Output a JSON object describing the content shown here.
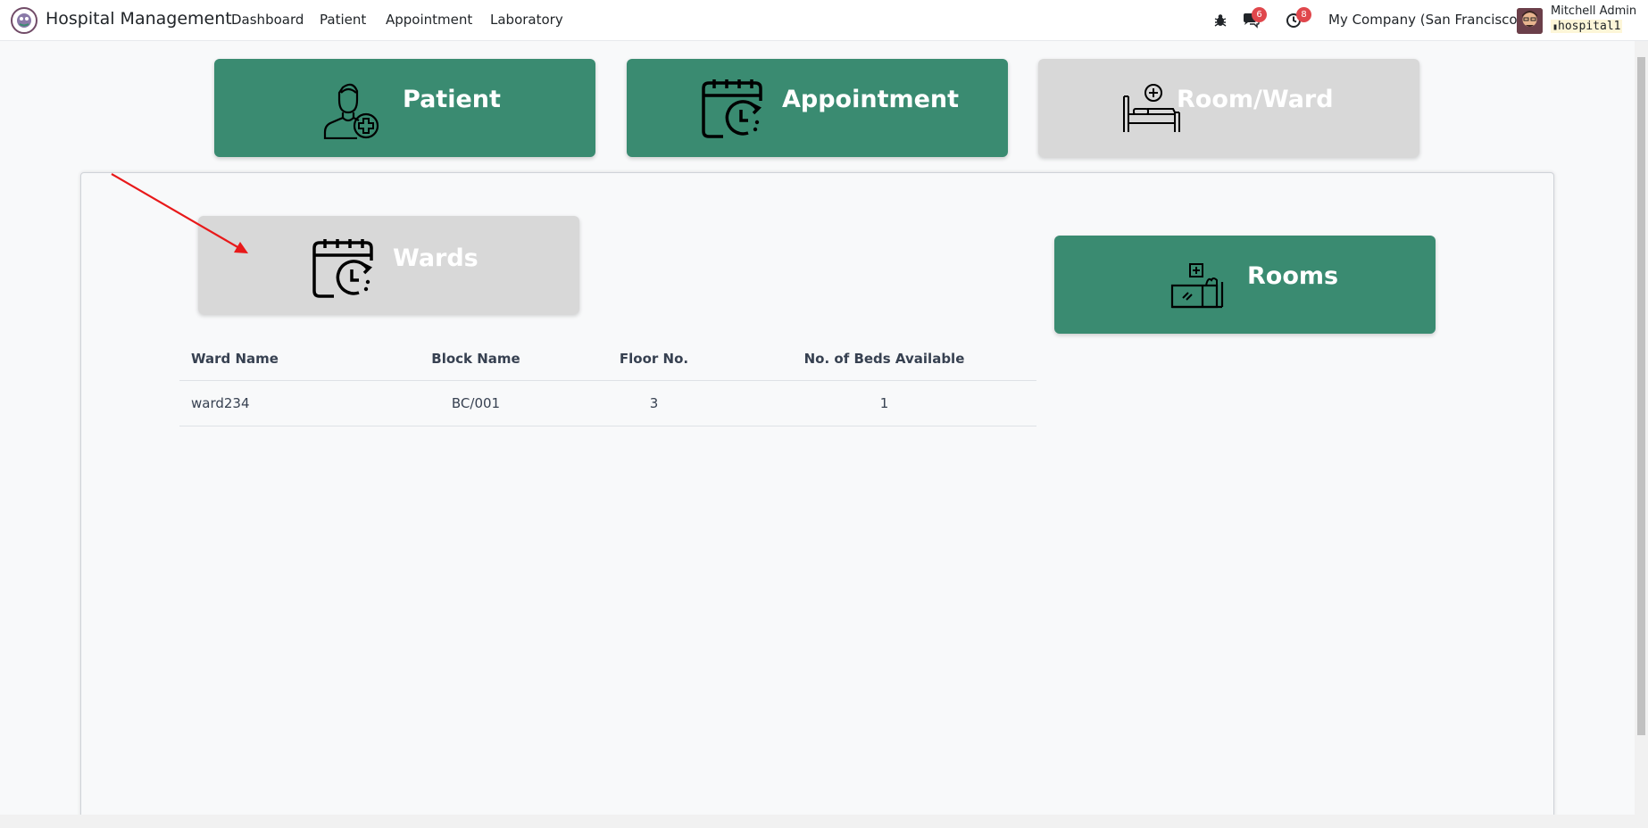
{
  "navbar": {
    "app_name": "Hospital Management",
    "menu": [
      "Dashboard",
      "Patient",
      "Appointment",
      "Laboratory"
    ],
    "messages_count": "6",
    "activities_count": "8",
    "company": "My Company (San Francisco)",
    "user_name": "Mitchell Admin",
    "db_name": "hospital1"
  },
  "cards": {
    "patient": "Patient",
    "appointment": "Appointment",
    "room_ward": "Room/Ward"
  },
  "panel": {
    "wards_button": "Wards",
    "rooms_button": "Rooms",
    "table": {
      "headers": [
        "Ward Name",
        "Block Name",
        "Floor No.",
        "No. of Beds Available"
      ],
      "rows": [
        [
          "ward234",
          "BC/001",
          "3",
          "1"
        ]
      ]
    }
  },
  "colors": {
    "accent_green": "#3a8b71",
    "inactive_grey": "#d8d8d8",
    "annotation_arrow": "#e8191a",
    "badge_red": "#e0474c"
  }
}
